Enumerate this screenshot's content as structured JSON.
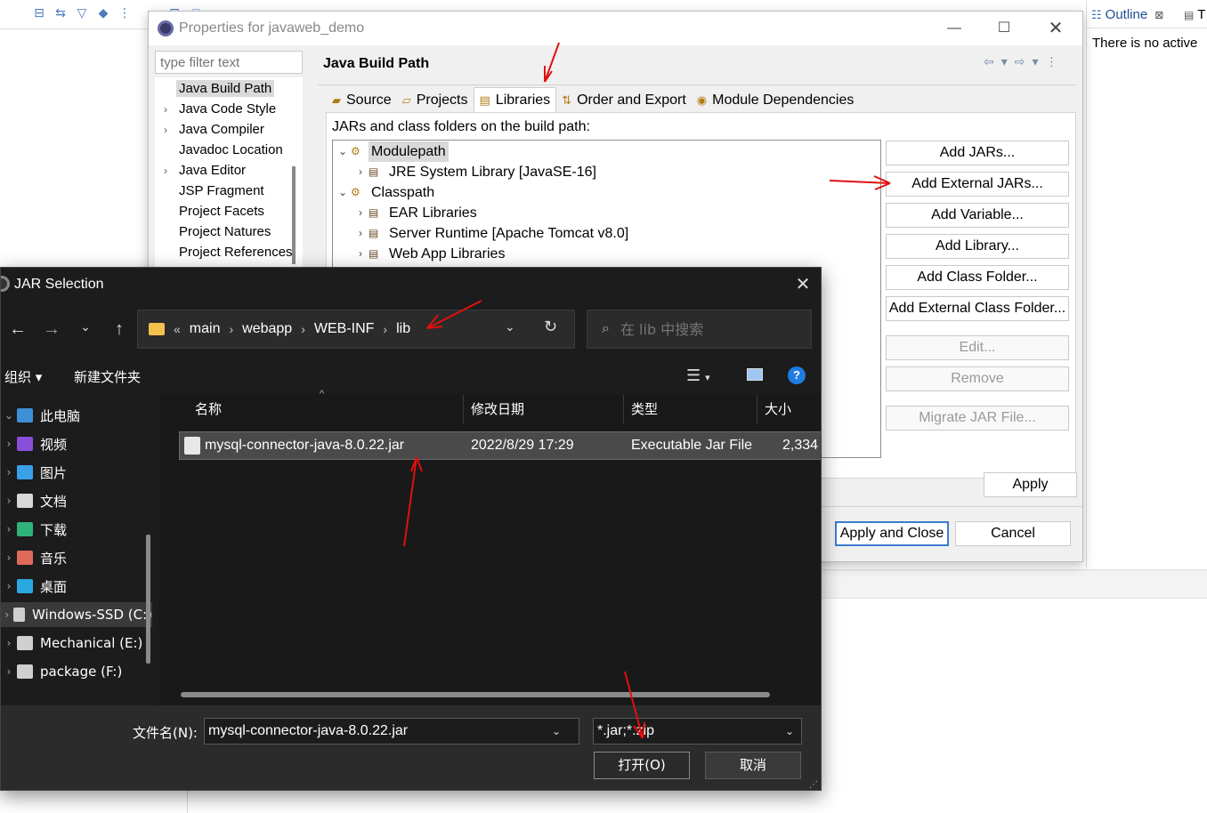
{
  "background": {
    "outline_tab": {
      "label": "Outline",
      "close": "⊠"
    },
    "t_tab": "T",
    "outline_message": "There is no active"
  },
  "properties_dialog": {
    "title": "Properties for javaweb_demo",
    "filter_placeholder": "type filter text",
    "nav_items": [
      {
        "label": "Java Build Path",
        "expandable": false,
        "selected": true
      },
      {
        "label": "Java Code Style",
        "expandable": true
      },
      {
        "label": "Java Compiler",
        "expandable": true
      },
      {
        "label": "Javadoc Location",
        "expandable": false
      },
      {
        "label": "Java Editor",
        "expandable": true
      },
      {
        "label": "JSP Fragment",
        "expandable": false
      },
      {
        "label": "Project Facets",
        "expandable": false
      },
      {
        "label": "Project Natures",
        "expandable": false
      },
      {
        "label": "Project References",
        "expandable": false
      }
    ],
    "page_title": "Java Build Path",
    "tabs": [
      {
        "label": "Source",
        "icon": "source-icon"
      },
      {
        "label": "Projects",
        "icon": "projects-icon"
      },
      {
        "label": "Libraries",
        "icon": "libraries-icon",
        "active": true
      },
      {
        "label": "Order and Export",
        "icon": "order-icon"
      },
      {
        "label": "Module Dependencies",
        "icon": "module-icon"
      }
    ],
    "jars_label": "JARs and class folders on the build path:",
    "tree": [
      {
        "label": "Modulepath",
        "level": 0,
        "expanded": true,
        "selected": true
      },
      {
        "label": "JRE System Library [JavaSE-16]",
        "level": 1,
        "expanded": false
      },
      {
        "label": "Classpath",
        "level": 0,
        "expanded": true
      },
      {
        "label": "EAR Libraries",
        "level": 1,
        "expanded": false
      },
      {
        "label": "Server Runtime [Apache Tomcat v8.0]",
        "level": 1,
        "expanded": false
      },
      {
        "label": "Web App Libraries",
        "level": 1,
        "expanded": false
      }
    ],
    "buttons": {
      "add_jars": "Add JARs...",
      "add_external_jars": "Add External JARs...",
      "add_variable": "Add Variable...",
      "add_library": "Add Library...",
      "add_class_folder": "Add Class Folder...",
      "add_external_class_folder": "Add External Class Folder...",
      "edit": "Edit...",
      "remove": "Remove",
      "migrate_jar": "Migrate JAR File...",
      "apply": "Apply",
      "apply_and_close": "Apply and Close",
      "cancel": "Cancel"
    }
  },
  "jar_selection": {
    "title": "JAR Selection",
    "breadcrumb": [
      "main",
      "webapp",
      "WEB-INF",
      "lib"
    ],
    "breadcrumb_overflow": "«",
    "search_placeholder": "在 lib 中搜索",
    "organize": "组织 ▾",
    "new_folder": "新建文件夹",
    "help": "?",
    "nav_items": [
      {
        "label": "此电脑",
        "icon": "pc-icon",
        "color": "#3d8fd8"
      },
      {
        "label": "视频",
        "icon": "video-icon",
        "color": "#8a4fd8"
      },
      {
        "label": "图片",
        "icon": "pictures-icon",
        "color": "#3aa0e8"
      },
      {
        "label": "文档",
        "icon": "documents-icon",
        "color": "#d8d8d8"
      },
      {
        "label": "下载",
        "icon": "downloads-icon",
        "color": "#2fb37a"
      },
      {
        "label": "音乐",
        "icon": "music-icon",
        "color": "#e06a5a"
      },
      {
        "label": "桌面",
        "icon": "desktop-icon",
        "color": "#2aa8e0"
      },
      {
        "label": "Windows-SSD (C:)",
        "icon": "drive-icon",
        "color": "#cfcfcf",
        "selected": true
      },
      {
        "label": "Mechanical (E:)",
        "icon": "drive-icon",
        "color": "#cfcfcf"
      },
      {
        "label": "package (F:)",
        "icon": "drive-icon",
        "color": "#cfcfcf"
      }
    ],
    "columns": [
      "名称",
      "修改日期",
      "类型",
      "大小"
    ],
    "file": {
      "name": "mysql-connector-java-8.0.22.jar",
      "modified": "2022/8/29 17:29",
      "type": "Executable Jar File",
      "size": "2,334"
    },
    "filename_label": "文件名(N):",
    "filename_value": "mysql-connector-java-8.0.22.jar",
    "filetype": "*.jar;*.zip",
    "open": "打开(O)",
    "cancel": "取消"
  },
  "colors": {
    "accent": "#3b7bd0",
    "annotation_arrow": "#e01010",
    "dark_dialog": "#1c1c1c"
  }
}
